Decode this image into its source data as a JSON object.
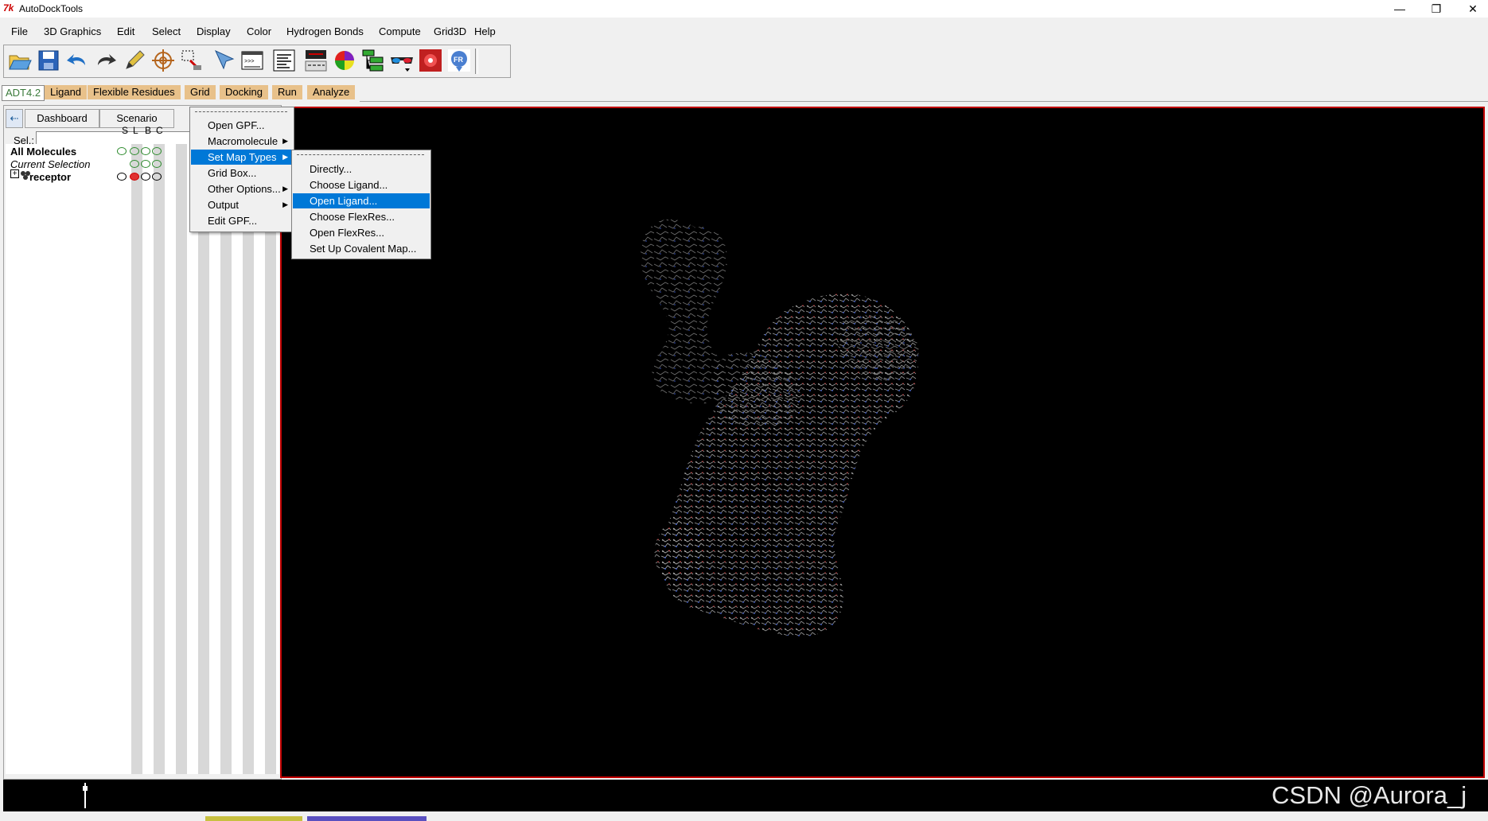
{
  "window": {
    "logo": "7k",
    "title": "AutoDockTools",
    "minimize_glyph": "—",
    "maximize_glyph": "❐",
    "close_glyph": "✕"
  },
  "menubar": {
    "items": [
      "File",
      "3D Graphics",
      "Edit",
      "Select",
      "Display",
      "Color",
      "Hydrogen Bonds",
      "Compute",
      "Grid3D",
      "Help"
    ]
  },
  "toolbar": {
    "icons": [
      "open-file-icon",
      "save-icon",
      "undo-icon",
      "redo-icon",
      "pencil-icon",
      "target-icon",
      "select-region-icon",
      "pointer-icon",
      "python-shell-icon",
      "text-lines-icon",
      "display-panel-icon",
      "color-sphere-icon",
      "tree-view-icon",
      "stereo-glasses-icon",
      "dashboard-red-icon",
      "fr-logo-icon"
    ]
  },
  "adtbar": {
    "version": "ADT4.2",
    "items": [
      "Ligand",
      "Flexible Residues",
      "Grid",
      "Docking",
      "Run",
      "Analyze"
    ]
  },
  "leftpanel": {
    "tabs": [
      "Dashboard",
      "Scenario"
    ],
    "sel_label": "Sel.:",
    "sel_value": "",
    "column_headers": [
      "S",
      "L",
      "B",
      "C"
    ],
    "tree": {
      "all_molecules": "All Molecules",
      "current_selection": "Current Selection",
      "expand_glyph": "+",
      "molecule": "receptor"
    }
  },
  "grid_menu": {
    "items": [
      {
        "label": "Open GPF...",
        "submenu": false,
        "selected": false
      },
      {
        "label": "Macromolecule",
        "submenu": true,
        "selected": false
      },
      {
        "label": "Set Map Types",
        "submenu": true,
        "selected": true
      },
      {
        "label": "Grid Box...",
        "submenu": false,
        "selected": false
      },
      {
        "label": "Other Options...",
        "submenu": true,
        "selected": false
      },
      {
        "label": "Output",
        "submenu": true,
        "selected": false
      },
      {
        "label": "Edit GPF...",
        "submenu": false,
        "selected": false
      }
    ]
  },
  "map_types_menu": {
    "items": [
      {
        "label": "Directly...",
        "selected": false
      },
      {
        "label": "Choose Ligand...",
        "selected": false
      },
      {
        "label": "Open Ligand...",
        "selected": true
      },
      {
        "label": "Choose FlexRes...",
        "selected": false
      },
      {
        "label": "Open FlexRes...",
        "selected": false
      },
      {
        "label": "Set Up Covalent Map...",
        "selected": false
      }
    ]
  },
  "watermark": "CSDN @Aurora_j",
  "colors": {
    "accent_selected": "#0078d7",
    "adt_menu_bg": "#e8c18a",
    "viewer_border": "#c00000",
    "viewer_bg": "#000000"
  }
}
